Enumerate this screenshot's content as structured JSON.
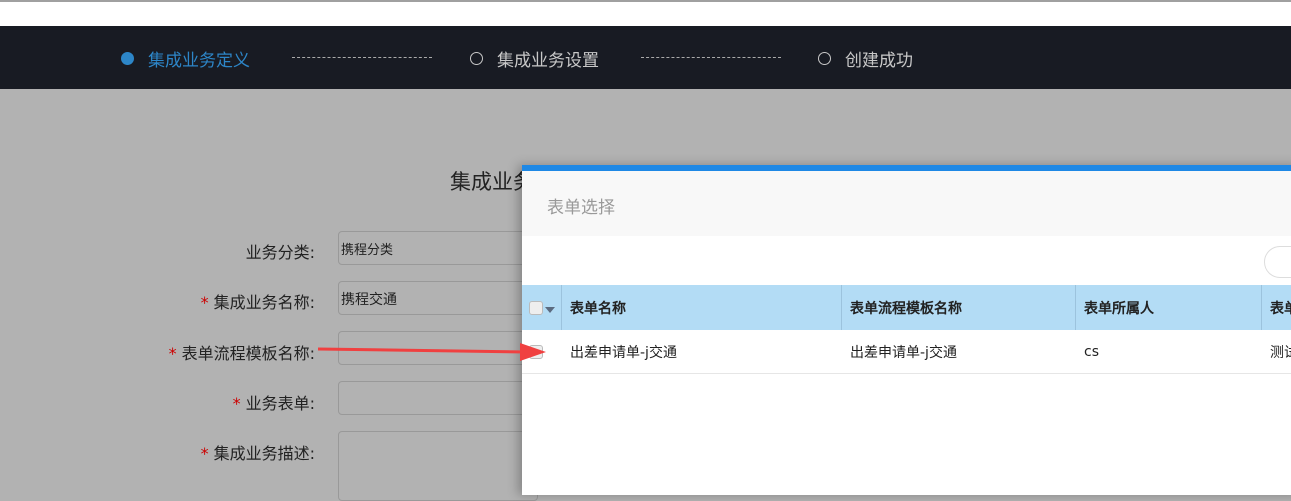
{
  "steps": [
    {
      "label": "集成业务定义",
      "active": true
    },
    {
      "label": "集成业务设置",
      "active": false
    },
    {
      "label": "创建成功",
      "active": false
    }
  ],
  "form": {
    "title": "集成业务",
    "fields": [
      {
        "label": "业务分类:",
        "required": false,
        "value": "携程分类"
      },
      {
        "label": "集成业务名称:",
        "required": true,
        "value": "携程交通"
      },
      {
        "label": "表单流程模板名称:",
        "required": true,
        "value": ""
      },
      {
        "label": "业务表单:",
        "required": true,
        "value": ""
      },
      {
        "label": "集成业务描述:",
        "required": true,
        "value": ""
      }
    ]
  },
  "modal": {
    "title": "表单选择",
    "columns": [
      "表单名称",
      "表单流程模板名称",
      "表单所属人",
      "表单"
    ],
    "rows": [
      [
        "出差申请单-j交通",
        "出差申请单-j交通",
        "cs",
        "测试"
      ]
    ]
  },
  "colors": {
    "nav_bg": "#181b23",
    "active_step": "#2d86c8",
    "modal_accent": "#1e88e5",
    "table_header": "#b3dcf5",
    "arrow": "#f04040"
  }
}
